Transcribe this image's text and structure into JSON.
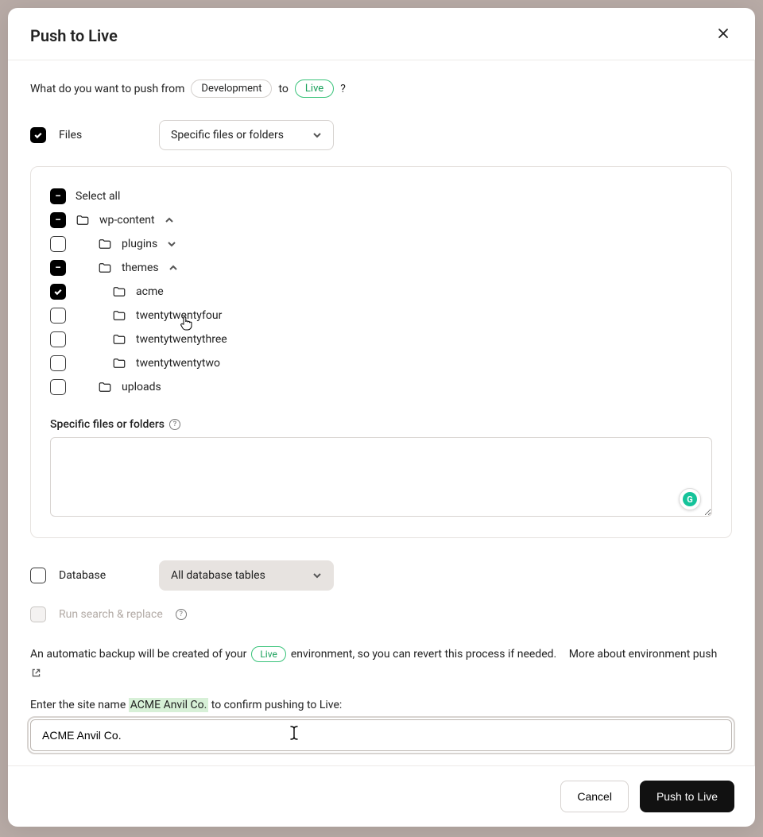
{
  "header": {
    "title": "Push to Live"
  },
  "prompt": {
    "prefix": "What do you want to push from",
    "from_env": "Development",
    "mid": "to",
    "to_env": "Live",
    "suffix": "?"
  },
  "files": {
    "checkbox_label": "Files",
    "select_value": "Specific files or folders"
  },
  "tree": {
    "select_all": "Select all",
    "root": {
      "name": "wp-content"
    },
    "plugins": "plugins",
    "themes": "themes",
    "theme_children": [
      "acme",
      "twentytwentyfour",
      "twentytwentythree",
      "twentytwentytwo"
    ],
    "uploads": "uploads"
  },
  "specific": {
    "label": "Specific files or folders"
  },
  "database": {
    "label": "Database",
    "select_value": "All database tables"
  },
  "searchreplace": {
    "label": "Run search & replace"
  },
  "backup": {
    "pre": "An automatic backup will be created of your",
    "env": "Live",
    "post": "environment, so you can revert this process if needed.",
    "link": "More about environment push"
  },
  "confirm": {
    "pre": "Enter the site name",
    "site": "ACME Anvil Co.",
    "post": "to confirm pushing to Live:",
    "value": "ACME Anvil Co."
  },
  "footer": {
    "cancel": "Cancel",
    "submit": "Push to Live"
  }
}
